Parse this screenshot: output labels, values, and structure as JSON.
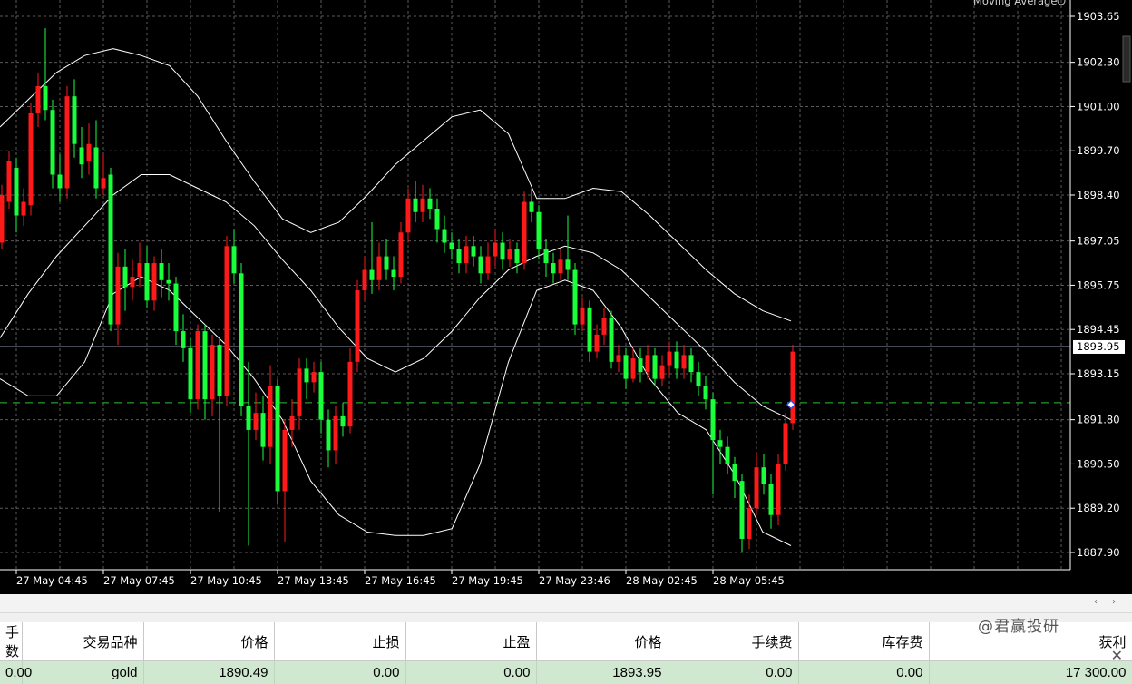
{
  "chart": {
    "indicator_label": "Moving Average",
    "current_price_label": "1893.95",
    "price_axis": {
      "max": 1903.65,
      "min": 1887.9,
      "labels": [
        "1903.65",
        "1902.30",
        "1901.00",
        "1899.70",
        "1898.40",
        "1897.05",
        "1895.75",
        "1894.45",
        "1893.15",
        "1891.80",
        "1890.50",
        "1889.20",
        "1887.90"
      ]
    },
    "time_axis": [
      "27 May 04:45",
      "27 May 07:45",
      "27 May 10:45",
      "27 May 13:45",
      "27 May 16:45",
      "27 May 19:45",
      "27 May 23:46",
      "28 May 02:45",
      "28 May 05:45"
    ],
    "colors": {
      "up": "#ff1a1a",
      "down": "#19ff3c",
      "grid": "#5a5a5a",
      "axis_text": "#ffffff",
      "band": "#ffffff",
      "dashed_level": "#2ec02e",
      "current_line": "#8891a8"
    }
  },
  "chart_data": {
    "type": "candlestick",
    "levels": {
      "current": 1893.95,
      "dashed": [
        1892.3,
        1890.5
      ]
    },
    "candles": [
      {
        "o": 1897.0,
        "c": 1898.4,
        "h": 1898.7,
        "l": 1896.8
      },
      {
        "o": 1898.2,
        "c": 1899.4,
        "h": 1899.7,
        "l": 1898.0
      },
      {
        "o": 1899.2,
        "c": 1897.8,
        "h": 1899.5,
        "l": 1897.3
      },
      {
        "o": 1897.8,
        "c": 1898.2,
        "h": 1898.6,
        "l": 1897.5
      },
      {
        "o": 1898.1,
        "c": 1900.8,
        "h": 1901.1,
        "l": 1897.8
      },
      {
        "o": 1900.8,
        "c": 1901.6,
        "h": 1902.0,
        "l": 1900.4
      },
      {
        "o": 1901.6,
        "c": 1900.9,
        "h": 1903.3,
        "l": 1900.6
      },
      {
        "o": 1900.9,
        "c": 1899.0,
        "h": 1901.2,
        "l": 1898.6
      },
      {
        "o": 1899.0,
        "c": 1898.6,
        "h": 1899.6,
        "l": 1898.2
      },
      {
        "o": 1898.6,
        "c": 1901.3,
        "h": 1901.6,
        "l": 1898.3
      },
      {
        "o": 1901.3,
        "c": 1899.9,
        "h": 1901.8,
        "l": 1899.5
      },
      {
        "o": 1899.8,
        "c": 1899.3,
        "h": 1900.4,
        "l": 1898.9
      },
      {
        "o": 1899.4,
        "c": 1899.9,
        "h": 1900.5,
        "l": 1899.0
      },
      {
        "o": 1899.8,
        "c": 1898.6,
        "h": 1900.6,
        "l": 1898.3
      },
      {
        "o": 1898.6,
        "c": 1898.9,
        "h": 1899.6,
        "l": 1898.4
      },
      {
        "o": 1899.0,
        "c": 1894.6,
        "h": 1899.2,
        "l": 1894.4
      },
      {
        "o": 1894.6,
        "c": 1896.3,
        "h": 1896.7,
        "l": 1894.0
      },
      {
        "o": 1896.3,
        "c": 1895.7,
        "h": 1896.8,
        "l": 1895.0
      },
      {
        "o": 1895.7,
        "c": 1896.0,
        "h": 1896.5,
        "l": 1895.3
      },
      {
        "o": 1896.0,
        "c": 1896.4,
        "h": 1897.0,
        "l": 1895.7
      },
      {
        "o": 1896.4,
        "c": 1895.3,
        "h": 1896.9,
        "l": 1895.1
      },
      {
        "o": 1895.3,
        "c": 1896.4,
        "h": 1896.6,
        "l": 1895.0
      },
      {
        "o": 1896.4,
        "c": 1895.9,
        "h": 1896.8,
        "l": 1895.4
      },
      {
        "o": 1895.9,
        "c": 1895.8,
        "h": 1896.4,
        "l": 1895.3
      },
      {
        "o": 1895.8,
        "c": 1894.4,
        "h": 1896.0,
        "l": 1894.0
      },
      {
        "o": 1894.4,
        "c": 1893.9,
        "h": 1894.9,
        "l": 1893.5
      },
      {
        "o": 1893.9,
        "c": 1892.4,
        "h": 1894.2,
        "l": 1892.0
      },
      {
        "o": 1892.4,
        "c": 1894.4,
        "h": 1894.6,
        "l": 1892.1
      },
      {
        "o": 1894.4,
        "c": 1892.4,
        "h": 1894.6,
        "l": 1891.8
      },
      {
        "o": 1892.4,
        "c": 1894.0,
        "h": 1894.3,
        "l": 1891.9
      },
      {
        "o": 1894.0,
        "c": 1892.5,
        "h": 1894.2,
        "l": 1889.1
      },
      {
        "o": 1892.5,
        "c": 1896.9,
        "h": 1897.2,
        "l": 1892.2
      },
      {
        "o": 1896.9,
        "c": 1896.1,
        "h": 1897.4,
        "l": 1895.8
      },
      {
        "o": 1896.1,
        "c": 1892.2,
        "h": 1896.4,
        "l": 1891.9
      },
      {
        "o": 1892.2,
        "c": 1891.5,
        "h": 1893.5,
        "l": 1888.1
      },
      {
        "o": 1891.5,
        "c": 1892.0,
        "h": 1892.6,
        "l": 1891.2
      },
      {
        "o": 1892.0,
        "c": 1891.0,
        "h": 1892.5,
        "l": 1890.6
      },
      {
        "o": 1891.0,
        "c": 1892.8,
        "h": 1893.4,
        "l": 1890.5
      },
      {
        "o": 1892.8,
        "c": 1889.7,
        "h": 1893.0,
        "l": 1889.3
      },
      {
        "o": 1889.7,
        "c": 1891.5,
        "h": 1891.8,
        "l": 1888.2
      },
      {
        "o": 1891.5,
        "c": 1891.9,
        "h": 1892.4,
        "l": 1891.0
      },
      {
        "o": 1891.9,
        "c": 1893.3,
        "h": 1893.6,
        "l": 1891.5
      },
      {
        "o": 1893.3,
        "c": 1892.9,
        "h": 1893.6,
        "l": 1892.4
      },
      {
        "o": 1892.9,
        "c": 1893.2,
        "h": 1893.5,
        "l": 1892.6
      },
      {
        "o": 1893.2,
        "c": 1891.8,
        "h": 1893.5,
        "l": 1891.4
      },
      {
        "o": 1891.8,
        "c": 1890.9,
        "h": 1892.1,
        "l": 1890.4
      },
      {
        "o": 1890.9,
        "c": 1891.9,
        "h": 1892.2,
        "l": 1890.5
      },
      {
        "o": 1891.9,
        "c": 1891.6,
        "h": 1892.3,
        "l": 1891.3
      },
      {
        "o": 1891.6,
        "c": 1893.5,
        "h": 1893.9,
        "l": 1891.4
      },
      {
        "o": 1893.5,
        "c": 1895.6,
        "h": 1895.9,
        "l": 1893.2
      },
      {
        "o": 1895.6,
        "c": 1896.2,
        "h": 1896.6,
        "l": 1895.3
      },
      {
        "o": 1896.2,
        "c": 1895.9,
        "h": 1897.6,
        "l": 1895.5
      },
      {
        "o": 1895.9,
        "c": 1896.6,
        "h": 1897.0,
        "l": 1895.6
      },
      {
        "o": 1896.6,
        "c": 1896.2,
        "h": 1897.1,
        "l": 1895.9
      },
      {
        "o": 1896.2,
        "c": 1896.0,
        "h": 1896.6,
        "l": 1895.6
      },
      {
        "o": 1896.0,
        "c": 1897.3,
        "h": 1897.6,
        "l": 1895.8
      },
      {
        "o": 1897.3,
        "c": 1898.3,
        "h": 1898.6,
        "l": 1897.0
      },
      {
        "o": 1898.3,
        "c": 1897.9,
        "h": 1898.8,
        "l": 1897.6
      },
      {
        "o": 1897.9,
        "c": 1898.3,
        "h": 1898.7,
        "l": 1897.6
      },
      {
        "o": 1898.3,
        "c": 1898.0,
        "h": 1898.6,
        "l": 1897.7
      },
      {
        "o": 1898.0,
        "c": 1897.4,
        "h": 1898.3,
        "l": 1897.0
      },
      {
        "o": 1897.4,
        "c": 1897.0,
        "h": 1897.8,
        "l": 1896.7
      },
      {
        "o": 1897.0,
        "c": 1896.8,
        "h": 1897.3,
        "l": 1896.5
      },
      {
        "o": 1896.8,
        "c": 1896.4,
        "h": 1897.1,
        "l": 1896.1
      },
      {
        "o": 1896.4,
        "c": 1896.9,
        "h": 1897.2,
        "l": 1896.1
      },
      {
        "o": 1896.9,
        "c": 1896.6,
        "h": 1897.2,
        "l": 1896.3
      },
      {
        "o": 1896.6,
        "c": 1896.1,
        "h": 1896.9,
        "l": 1895.8
      },
      {
        "o": 1896.1,
        "c": 1896.6,
        "h": 1897.0,
        "l": 1895.9
      },
      {
        "o": 1896.6,
        "c": 1897.0,
        "h": 1897.4,
        "l": 1896.3
      },
      {
        "o": 1897.0,
        "c": 1896.5,
        "h": 1897.3,
        "l": 1896.2
      },
      {
        "o": 1896.5,
        "c": 1896.8,
        "h": 1897.1,
        "l": 1896.3
      },
      {
        "o": 1896.8,
        "c": 1896.4,
        "h": 1897.0,
        "l": 1896.1
      },
      {
        "o": 1896.4,
        "c": 1898.2,
        "h": 1898.5,
        "l": 1896.2
      },
      {
        "o": 1898.2,
        "c": 1897.9,
        "h": 1898.6,
        "l": 1897.6
      },
      {
        "o": 1897.9,
        "c": 1896.8,
        "h": 1898.1,
        "l": 1896.5
      },
      {
        "o": 1896.8,
        "c": 1896.4,
        "h": 1897.1,
        "l": 1896.0
      },
      {
        "o": 1896.4,
        "c": 1896.1,
        "h": 1896.7,
        "l": 1895.8
      },
      {
        "o": 1896.1,
        "c": 1896.5,
        "h": 1896.8,
        "l": 1895.9
      },
      {
        "o": 1896.5,
        "c": 1896.2,
        "h": 1897.8,
        "l": 1895.9
      },
      {
        "o": 1896.2,
        "c": 1894.6,
        "h": 1896.4,
        "l": 1894.3
      },
      {
        "o": 1894.6,
        "c": 1895.1,
        "h": 1895.4,
        "l": 1894.4
      },
      {
        "o": 1895.1,
        "c": 1893.8,
        "h": 1895.3,
        "l": 1893.5
      },
      {
        "o": 1893.8,
        "c": 1894.3,
        "h": 1894.6,
        "l": 1893.6
      },
      {
        "o": 1894.3,
        "c": 1894.8,
        "h": 1895.1,
        "l": 1894.0
      },
      {
        "o": 1894.8,
        "c": 1893.5,
        "h": 1895.0,
        "l": 1893.3
      },
      {
        "o": 1893.5,
        "c": 1893.7,
        "h": 1894.0,
        "l": 1893.2
      },
      {
        "o": 1893.7,
        "c": 1893.0,
        "h": 1893.9,
        "l": 1892.7
      },
      {
        "o": 1893.0,
        "c": 1893.6,
        "h": 1893.9,
        "l": 1892.9
      },
      {
        "o": 1893.6,
        "c": 1893.2,
        "h": 1893.9,
        "l": 1892.9
      },
      {
        "o": 1893.2,
        "c": 1893.7,
        "h": 1894.0,
        "l": 1893.0
      },
      {
        "o": 1893.7,
        "c": 1893.0,
        "h": 1893.9,
        "l": 1892.8
      },
      {
        "o": 1893.0,
        "c": 1893.4,
        "h": 1893.7,
        "l": 1892.8
      },
      {
        "o": 1893.4,
        "c": 1893.8,
        "h": 1894.1,
        "l": 1893.1
      },
      {
        "o": 1893.8,
        "c": 1893.3,
        "h": 1894.1,
        "l": 1893.0
      },
      {
        "o": 1893.3,
        "c": 1893.7,
        "h": 1894.0,
        "l": 1893.0
      },
      {
        "o": 1893.7,
        "c": 1893.2,
        "h": 1893.9,
        "l": 1892.9
      },
      {
        "o": 1893.2,
        "c": 1892.8,
        "h": 1893.5,
        "l": 1892.5
      },
      {
        "o": 1892.8,
        "c": 1892.4,
        "h": 1893.1,
        "l": 1892.1
      },
      {
        "o": 1892.4,
        "c": 1891.2,
        "h": 1892.6,
        "l": 1889.6
      },
      {
        "o": 1891.2,
        "c": 1891.0,
        "h": 1891.5,
        "l": 1890.5
      },
      {
        "o": 1891.0,
        "c": 1890.5,
        "h": 1891.3,
        "l": 1890.2
      },
      {
        "o": 1890.5,
        "c": 1890.0,
        "h": 1890.7,
        "l": 1889.5
      },
      {
        "o": 1890.0,
        "c": 1888.3,
        "h": 1890.2,
        "l": 1887.9
      },
      {
        "o": 1888.3,
        "c": 1889.2,
        "h": 1889.6,
        "l": 1888.0
      },
      {
        "o": 1889.2,
        "c": 1890.4,
        "h": 1890.8,
        "l": 1889.0
      },
      {
        "o": 1890.4,
        "c": 1889.9,
        "h": 1890.8,
        "l": 1889.6
      },
      {
        "o": 1889.9,
        "c": 1889.0,
        "h": 1890.2,
        "l": 1888.6
      },
      {
        "o": 1889.0,
        "c": 1890.5,
        "h": 1890.8,
        "l": 1888.7
      },
      {
        "o": 1890.5,
        "c": 1891.7,
        "h": 1892.0,
        "l": 1890.3
      },
      {
        "o": 1891.7,
        "c": 1893.8,
        "h": 1894.0,
        "l": 1891.5
      }
    ],
    "bollinger": {
      "upper": [
        1900.4,
        1901.2,
        1902.0,
        1902.5,
        1902.7,
        1902.5,
        1902.2,
        1901.3,
        1900.0,
        1898.8,
        1897.7,
        1897.3,
        1897.6,
        1898.4,
        1899.3,
        1900.0,
        1900.7,
        1900.9,
        1900.2,
        1898.3,
        1898.3,
        1898.6,
        1898.5,
        1897.8,
        1897.0,
        1896.2,
        1895.5,
        1895.0,
        1894.7
      ],
      "middle": [
        1894.2,
        1895.5,
        1896.6,
        1897.5,
        1898.4,
        1899.0,
        1899.0,
        1898.6,
        1898.2,
        1897.5,
        1896.5,
        1895.6,
        1894.5,
        1893.6,
        1893.2,
        1893.6,
        1894.4,
        1895.4,
        1896.2,
        1896.6,
        1896.9,
        1896.7,
        1896.2,
        1895.4,
        1894.6,
        1893.8,
        1892.9,
        1892.2,
        1891.8
      ],
      "lower": [
        1893.0,
        1892.5,
        1892.5,
        1893.5,
        1895.5,
        1896.0,
        1895.6,
        1894.8,
        1894.0,
        1893.0,
        1891.8,
        1890.0,
        1889.0,
        1888.5,
        1888.4,
        1888.4,
        1888.6,
        1890.5,
        1893.5,
        1895.6,
        1895.9,
        1895.6,
        1894.5,
        1893.0,
        1892.0,
        1891.5,
        1890.2,
        1888.5,
        1888.1
      ]
    }
  },
  "scroll": {
    "left_arrow": "‹",
    "right_arrow": "›"
  },
  "orders": {
    "headers": [
      "手数",
      "交易品种",
      "价格",
      "止损",
      "止盈",
      "价格",
      "手续费",
      "库存费",
      "获利"
    ],
    "row": [
      "0.00",
      "gold",
      "1890.49",
      "0.00",
      "0.00",
      "1893.95",
      "0.00",
      "0.00",
      "17 300.00"
    ]
  },
  "watermark": "@君赢投研",
  "close_icon": "close-icon"
}
